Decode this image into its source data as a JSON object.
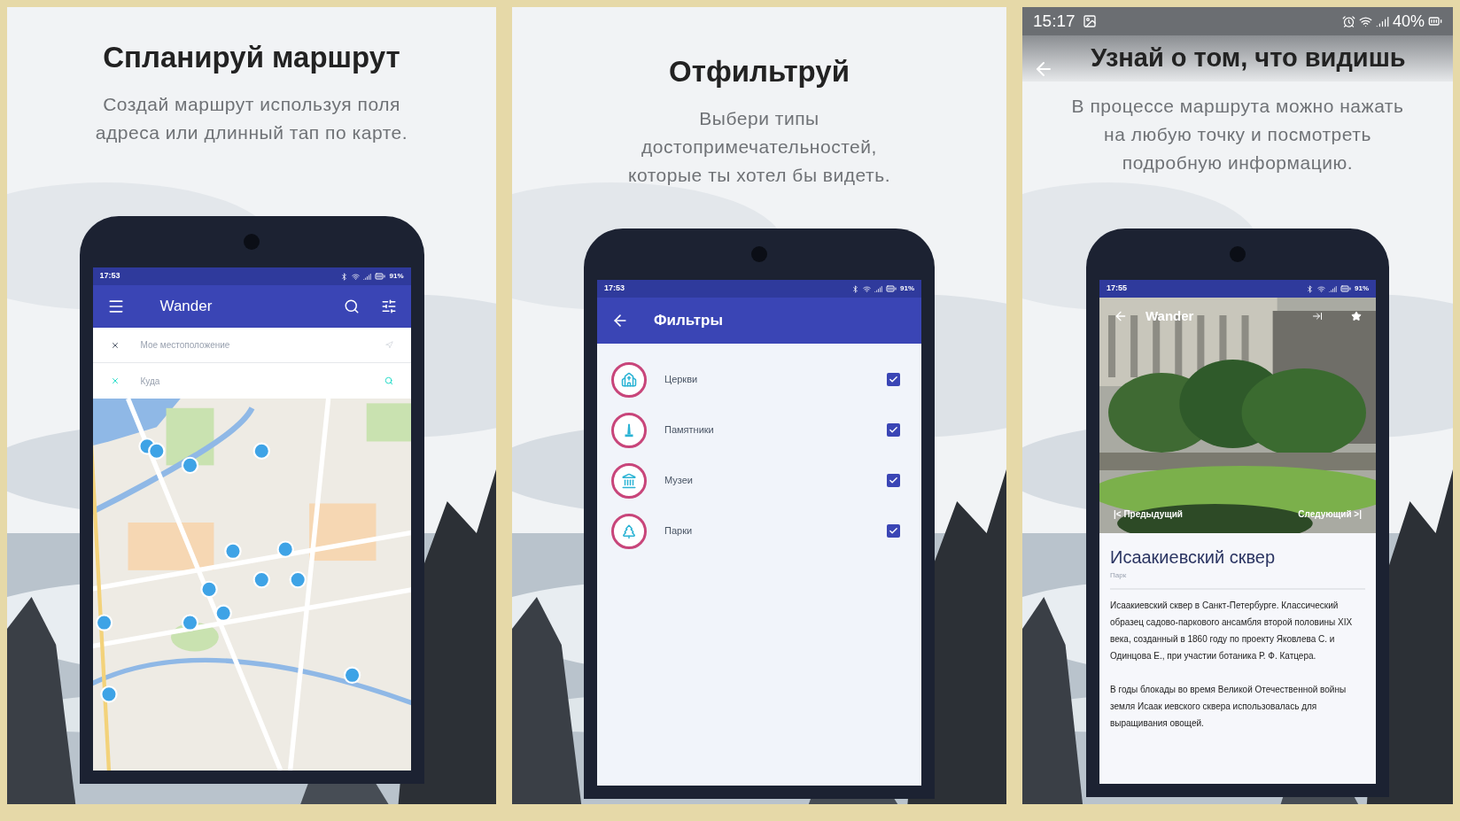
{
  "panels": [
    {
      "kind": "map",
      "title": "Спланируй маршрут",
      "subtitle_lines": [
        "Создай маршрут используя поля",
        "адреса или длинный тап по карте."
      ],
      "phone": {
        "status_time": "17:53",
        "battery": "91%",
        "app_title": "Wander",
        "fields": [
          {
            "placeholder": "Мое местоположение"
          },
          {
            "placeholder": "Куда"
          }
        ]
      }
    },
    {
      "kind": "filters",
      "title": "Отфильтруй",
      "subtitle_lines": [
        "Выбери типы",
        "достопримечательностей,",
        "которые ты хотел бы видеть."
      ],
      "phone": {
        "status_time": "17:53",
        "battery": "91%",
        "app_title": "Фильтры",
        "filters": [
          {
            "label": "Церкви",
            "checked": true
          },
          {
            "label": "Памятники",
            "checked": true
          },
          {
            "label": "Музеи",
            "checked": true
          },
          {
            "label": "Парки",
            "checked": true
          }
        ]
      }
    },
    {
      "kind": "details",
      "device_status": {
        "time": "15:17",
        "battery": "40%"
      },
      "title": "Узнай о том, что видишь",
      "subtitle_lines": [
        "В процессе маршрута можно нажать",
        "на любую точку и посмотреть",
        "подробную информацию."
      ],
      "phone": {
        "status_time": "17:55",
        "battery": "91%",
        "app_title": "Wander",
        "previous": "|< Предыдущий",
        "next": "Следующий >|",
        "place_title": "Исаакиевский сквер",
        "category": "Парк",
        "paragraphs": [
          "Исаакиевский сквер в Санкт-Петербурге. Классический образец садово-паркового ансамбля второй половины XIX века, созданный в 1860 году по проекту Яковлева С. и Одинцова Е., при участии ботаника Р. Ф. Катцера.",
          "В годы блокады во время Великой Отечественной войны земля Исаак иевского сквера использовалась для выращивания овощей."
        ]
      }
    }
  ]
}
